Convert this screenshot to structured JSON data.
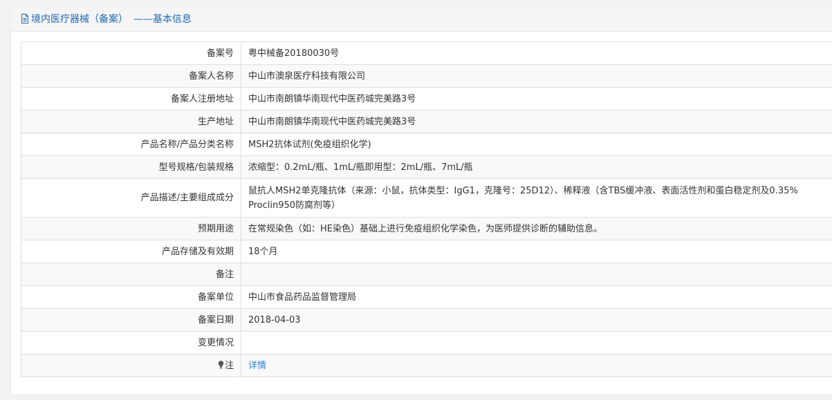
{
  "header": {
    "title": "境内医疗器械（备案）",
    "subtitle": "——基本信息",
    "icon": "document-icon",
    "accent_color": "#1f69b4"
  },
  "rows": [
    {
      "label": "备案号",
      "value": "粤中械备20180030号"
    },
    {
      "label": "备案人名称",
      "value": "中山市澳泉医疗科技有限公司"
    },
    {
      "label": "备案人注册地址",
      "value": "中山市南朗镇华南现代中医药城完美路3号"
    },
    {
      "label": "生产地址",
      "value": "中山市南朗镇华南现代中医药城完美路3号"
    },
    {
      "label": "产品名称/产品分类名称",
      "value": "MSH2抗体试剂(免疫组织化学)"
    },
    {
      "label": "型号规格/包装规格",
      "value": "浓缩型：0.2mL/瓶、1mL/瓶即用型：2mL/瓶、7mL/瓶"
    },
    {
      "label": "产品描述/主要组成成分",
      "value": "鼠抗人MSH2单克隆抗体（来源：小鼠，抗体类型：IgG1，克隆号：25D12）、稀释液（含TBS缓冲液、表面活性剂和蛋白稳定剂及0.35% Proclin950防腐剂等）"
    },
    {
      "label": "预期用途",
      "value": "在常规染色（如：HE染色）基础上进行免疫组织化学染色，为医师提供诊断的辅助信息。"
    },
    {
      "label": "产品存储及有效期",
      "value": "18个月"
    },
    {
      "label": "备注",
      "value": ""
    },
    {
      "label": "备案单位",
      "value": "中山市食品药品监督管理局"
    },
    {
      "label": "备案日期",
      "value": "2018-04-03"
    },
    {
      "label": "变更情况",
      "value": ""
    },
    {
      "label": "注",
      "value": "详情",
      "icon": "lightbulb-icon",
      "link_color": "#2a7ed6"
    }
  ]
}
